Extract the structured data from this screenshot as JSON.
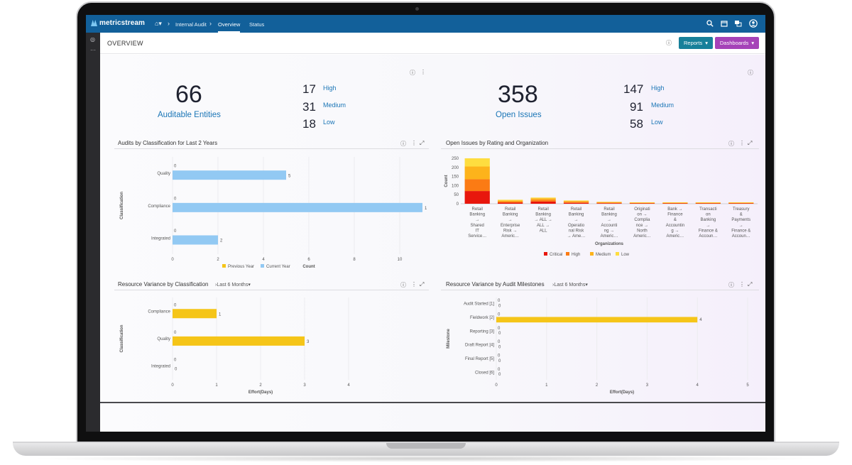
{
  "app": {
    "brand": "metricstream",
    "breadcrumb": [
      "Internal Audit",
      "Overview",
      "Status"
    ]
  },
  "header": {
    "title": "OVERVIEW",
    "reports_label": "Reports",
    "dashboards_label": "Dashboards"
  },
  "kpis": {
    "auditable": {
      "value": "66",
      "label": "Auditable Entities",
      "high": "17",
      "medium": "31",
      "low": "18"
    },
    "issues": {
      "value": "358",
      "label": "Open Issues",
      "high": "147",
      "medium": "91",
      "low": "58"
    },
    "labels": {
      "high": "High",
      "medium": "Medium",
      "low": "Low"
    }
  },
  "panels": {
    "audits": {
      "title": "Audits by Classification for Last 2 Years"
    },
    "openissues": {
      "title": "Open Issues by Rating and Organization"
    },
    "resclass": {
      "title": "Resource Variance by Classification",
      "range": "Last 6 Months"
    },
    "resmile": {
      "title": "Resource Variance by Audit Milestones",
      "range": "Last 6 Months"
    }
  },
  "colors": {
    "topbar": "#12609a",
    "blue_bar": "#92c9f3",
    "gold_bar": "#f5c518",
    "reports_btn": "#17809a",
    "dashboards_btn": "#a542b8"
  },
  "chart_data": [
    {
      "type": "bar",
      "orientation": "horizontal",
      "title": "Audits by Classification for Last 2 Years",
      "categories": [
        "Quality",
        "Compliance",
        "Integrated"
      ],
      "series": [
        {
          "name": "Previous Year",
          "values": [
            0,
            0,
            0
          ]
        },
        {
          "name": "Current Year",
          "values": [
            5,
            11,
            2
          ]
        }
      ],
      "xlabel": "Count",
      "ylabel": "Classification",
      "xlim": [
        0,
        12
      ],
      "xticks": [
        0,
        2,
        4,
        6,
        8,
        10,
        12
      ]
    },
    {
      "type": "bar",
      "stacked": true,
      "title": "Open Issues by Rating and Organization",
      "categories": [
        [
          "Retail",
          "Banking",
          "→",
          "Shared",
          "IT",
          "Service…"
        ],
        [
          "Retail",
          "Banking",
          "→",
          "Enterprise",
          "Risk →",
          "Americ…"
        ],
        [
          "Retail",
          "Banking",
          "→ ALL →",
          "ALL →",
          "ALL"
        ],
        [
          "Retail",
          "Banking",
          "→",
          "Operatio",
          "nal Risk",
          "→ Ame…"
        ],
        [
          "Retail",
          "Banking",
          "→",
          "Accounti",
          "ng →",
          "Americ…"
        ],
        [
          "Originati",
          "on →",
          "Complia",
          "nce →",
          "North",
          "Americ…"
        ],
        [
          "Bank →",
          "Finance",
          "&",
          "Accountin",
          "g →",
          "Americ…"
        ],
        [
          "Transacti",
          "on",
          "Banking",
          "→",
          "Finance &",
          "Accoun…"
        ],
        [
          "Treasury",
          "&",
          "Payments",
          "→",
          "Finance &",
          "Accoun…"
        ]
      ],
      "series": [
        {
          "name": "Critical",
          "values": [
            70,
            6,
            12,
            5,
            3,
            2,
            2,
            2,
            2
          ]
        },
        {
          "name": "High",
          "values": [
            65,
            6,
            10,
            5,
            3,
            2,
            2,
            2,
            2
          ]
        },
        {
          "name": "Medium",
          "values": [
            70,
            6,
            8,
            5,
            3,
            2,
            2,
            2,
            2
          ]
        },
        {
          "name": "Low",
          "values": [
            45,
            4,
            4,
            3,
            2,
            2,
            2,
            2,
            2
          ]
        }
      ],
      "xlabel": "Organizations",
      "ylabel": "Count",
      "ylim": [
        0,
        250
      ],
      "yticks": [
        0,
        50,
        100,
        150,
        200,
        250
      ]
    },
    {
      "type": "bar",
      "orientation": "horizontal",
      "title": "Resource Variance by Classification",
      "categories": [
        "Compliance",
        "Quality",
        "Integrated"
      ],
      "series": [
        {
          "values": [
            0,
            0,
            0
          ]
        },
        {
          "values": [
            1,
            3,
            0
          ]
        }
      ],
      "xlabel": "Effort(Days)",
      "ylabel": "Classification",
      "xlim": [
        0,
        4
      ],
      "xticks": [
        0,
        1,
        2,
        3,
        4
      ]
    },
    {
      "type": "bar",
      "orientation": "horizontal",
      "title": "Resource Variance by Audit Milestones",
      "categories": [
        "Audit Started [1]",
        "Fieldwork [2]",
        "Reporting [3]",
        "Draft Report [4]",
        "Final Report [5]",
        "Closed [6]"
      ],
      "series": [
        {
          "values": [
            0,
            0,
            0,
            0,
            0,
            0
          ]
        },
        {
          "values": [
            0,
            4,
            0,
            0,
            0,
            0
          ]
        }
      ],
      "xlabel": "Effort(Days)",
      "ylabel": "Milestone",
      "xlim": [
        0,
        5
      ],
      "xticks": [
        0,
        1,
        2,
        3,
        4,
        5
      ]
    }
  ]
}
